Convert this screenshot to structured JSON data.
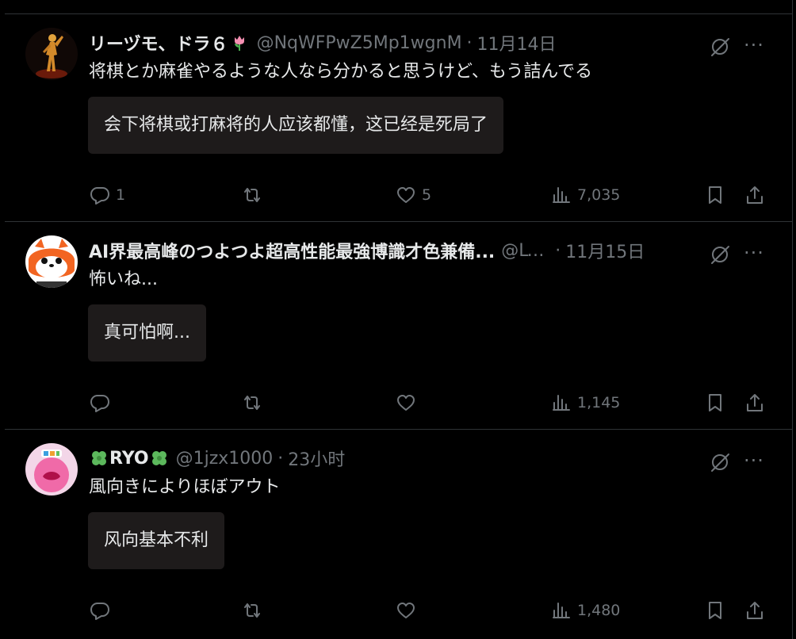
{
  "replies": [
    {
      "display_name": "リーヅモ、ドラ６",
      "handle": "@NqWFPwZ5Mp1wgnM",
      "time": "11月14日",
      "text": "将棋とか麻雀やるような人なら分かると思うけど、もう詰んでる",
      "translation": "会下将棋或打麻将的人应该都懂，这已经是死局了",
      "stats": {
        "replies": "1",
        "reposts": "",
        "likes": "5",
        "views": "7,035"
      }
    },
    {
      "display_name": "AI界最高峰のつよつよ超高性能最強博識才色兼備...",
      "handle": "@Ly...",
      "time": "11月15日",
      "text": "怖いね...",
      "translation": "真可怕啊...",
      "stats": {
        "replies": "",
        "reposts": "",
        "likes": "",
        "views": "1,145"
      }
    },
    {
      "display_name": "RYO",
      "handle": "@1jzx1000",
      "time": "23小时",
      "text": "風向きによりほぼアウト",
      "translation": "风向基本不利",
      "stats": {
        "replies": "",
        "reposts": "",
        "likes": "",
        "views": "1,480"
      }
    }
  ],
  "separator": "·",
  "colors": {
    "background": "#000000",
    "text": "#e7e9ea",
    "muted": "#71767b",
    "card": "#1e1b1b",
    "border": "#2f3336"
  },
  "icons": [
    "grok-icon",
    "more-icon",
    "reply-icon",
    "repost-icon",
    "like-icon",
    "views-icon",
    "bookmark-icon",
    "share-icon",
    "tulip-icon",
    "clover-icon"
  ]
}
